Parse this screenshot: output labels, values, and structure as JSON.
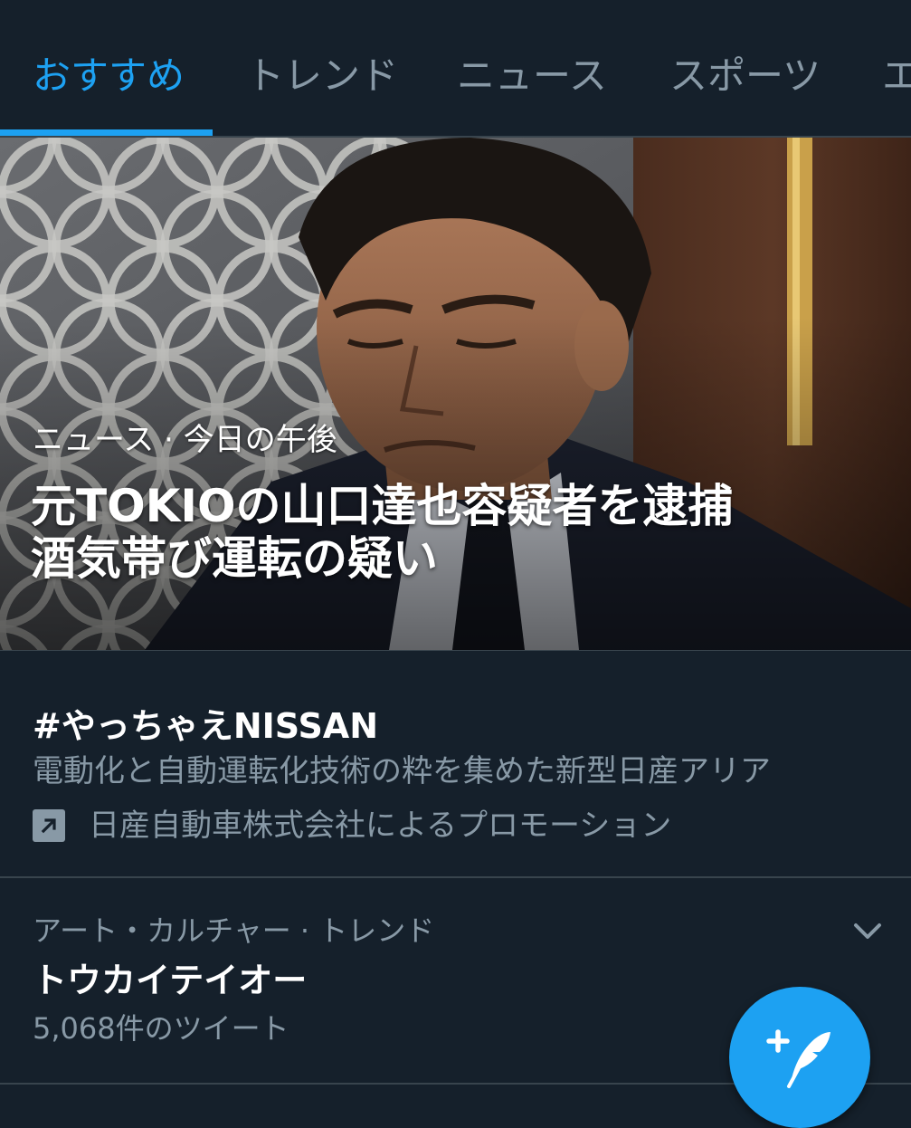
{
  "tabs": [
    {
      "label": "おすすめ",
      "active": true
    },
    {
      "label": "トレンド",
      "active": false
    },
    {
      "label": "ニュース",
      "active": false
    },
    {
      "label": "スポーツ",
      "active": false
    },
    {
      "label": "エ",
      "active": false
    }
  ],
  "hero": {
    "meta": "ニュース · 今日の午後",
    "headline_line1": "元TOKIOの山口達也容疑者を逮捕",
    "headline_line2": "酒気帯び運転の疑い"
  },
  "promoted_trend": {
    "title": "#やっちゃえNISSAN",
    "description": "電動化と自動運転化技術の粋を集めた新型日産アリア",
    "promoted_by": "日産自動車株式会社によるプロモーション",
    "icon": "promoted-arrow-icon"
  },
  "trend": {
    "category": "アート・カルチャー · トレンド",
    "name": "トウカイテイオー",
    "count": "5,068件のツイート",
    "menu_icon": "chevron-down-icon"
  },
  "fab": {
    "icon": "compose-tweet-icon"
  },
  "colors": {
    "background": "#15202b",
    "accent": "#1da1f2",
    "secondary_text": "#8899a6",
    "divider": "#38444d"
  }
}
